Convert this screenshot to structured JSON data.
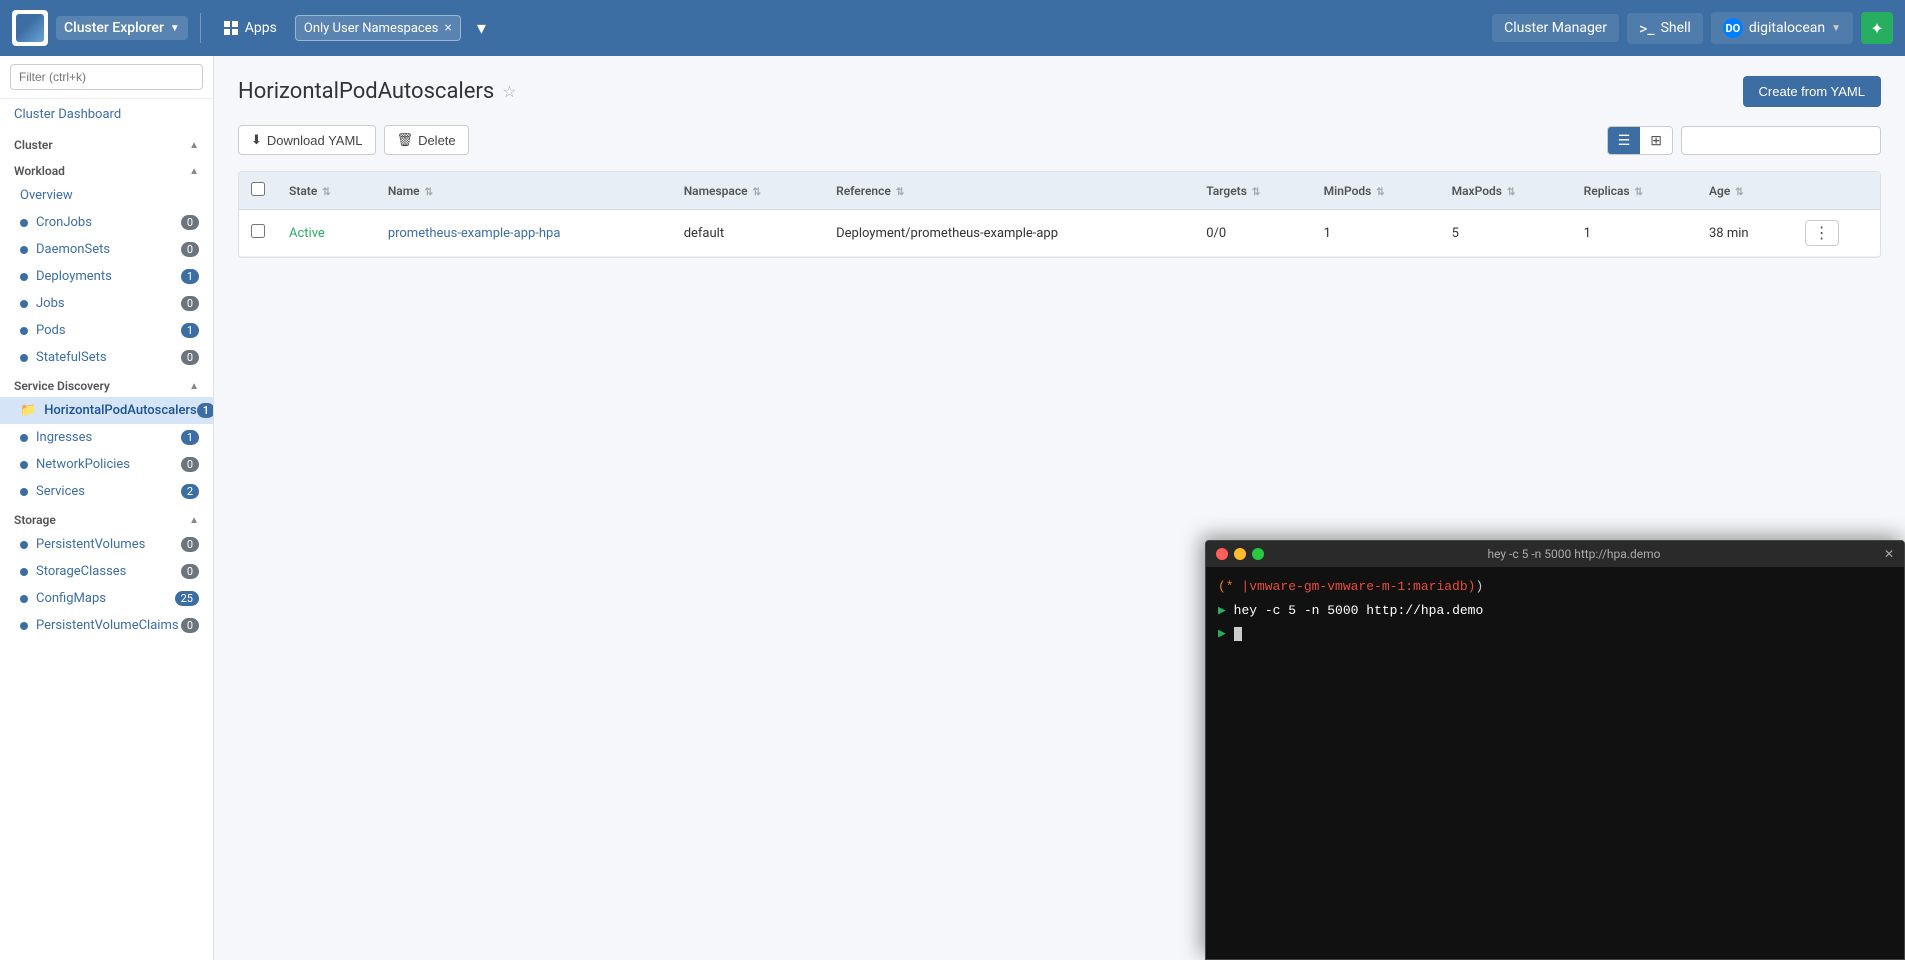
{
  "topbar": {
    "logo_alt": "Rancher",
    "cluster_label": "Cluster Explorer",
    "apps_label": "Apps",
    "namespace_filter": "Only User Namespaces",
    "cluster_manager_label": "Cluster Manager",
    "shell_label": "Shell",
    "digitalocean_label": "digitalocean"
  },
  "sidebar": {
    "search_placeholder": "Filter (ctrl+k)",
    "cluster_dashboard": "Cluster Dashboard",
    "cluster_section": "Cluster",
    "workload_section": "Workload",
    "workload_items": [
      {
        "label": "Overview",
        "count": null,
        "active": false
      },
      {
        "label": "CronJobs",
        "count": "0",
        "active": false
      },
      {
        "label": "DaemonSets",
        "count": "0",
        "active": false
      },
      {
        "label": "Deployments",
        "count": "1",
        "active": false
      },
      {
        "label": "Jobs",
        "count": "0",
        "active": false
      },
      {
        "label": "Pods",
        "count": "1",
        "active": false
      },
      {
        "label": "StatefulSets",
        "count": "0",
        "active": false
      }
    ],
    "service_discovery_section": "Service Discovery",
    "service_discovery_items": [
      {
        "label": "HorizontalPodAutoscalers",
        "count": "1",
        "active": true
      },
      {
        "label": "Ingresses",
        "count": "1",
        "active": false
      },
      {
        "label": "NetworkPolicies",
        "count": "0",
        "active": false
      },
      {
        "label": "Services",
        "count": "2",
        "active": false
      }
    ],
    "storage_section": "Storage",
    "storage_items": [
      {
        "label": "PersistentVolumes",
        "count": "0",
        "active": false
      },
      {
        "label": "StorageClasses",
        "count": "0",
        "active": false
      },
      {
        "label": "ConfigMaps",
        "count": "25",
        "active": false
      },
      {
        "label": "PersistentVolumeClaims",
        "count": "0",
        "active": false
      }
    ]
  },
  "main": {
    "page_title": "HorizontalPodAutoscalers",
    "create_yaml_btn": "Create from YAML",
    "download_yaml_btn": "Download YAML",
    "delete_btn": "Delete",
    "filter_placeholder": "",
    "table": {
      "columns": [
        "State",
        "Name",
        "Namespace",
        "Reference",
        "Targets",
        "MinPods",
        "MaxPods",
        "Replicas",
        "Age"
      ],
      "rows": [
        {
          "state": "Active",
          "name": "prometheus-example-app-hpa",
          "namespace": "default",
          "reference": "Deployment/prometheus-example-app",
          "targets": "0/0",
          "minPods": "1",
          "maxPods": "5",
          "replicas": "1",
          "age": "38 min"
        }
      ]
    }
  },
  "terminal": {
    "title": "hey -c 5 -n 5000 http://hpa.demo",
    "line1_marker": "(* |vmware-gm-vmware-m-1:mariadb)",
    "line2_cmd": "hey -c 5 -n 5000 http://hpa.demo",
    "prompt3": ""
  }
}
